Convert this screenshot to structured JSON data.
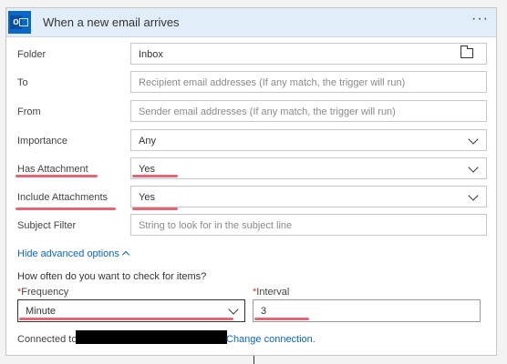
{
  "trigger": {
    "title": "When a new email arrives",
    "menu": "···"
  },
  "fields": {
    "folder": {
      "label": "Folder",
      "value": "Inbox"
    },
    "to": {
      "label": "To",
      "placeholder": "Recipient email addresses (If any match, the trigger will run)"
    },
    "from": {
      "label": "From",
      "placeholder": "Sender email addresses (If any match, the trigger will run)"
    },
    "importance": {
      "label": "Importance",
      "value": "Any"
    },
    "has_attachment": {
      "label": "Has Attachment",
      "value": "Yes"
    },
    "include_attachments": {
      "label": "Include Attachments",
      "value": "Yes"
    },
    "subject_filter": {
      "label": "Subject Filter",
      "placeholder": "String to look for in the subject line"
    }
  },
  "advanced": {
    "toggle_label": "Hide advanced options"
  },
  "schedule": {
    "question": "How often do you want to check for items?",
    "required_mark": "*",
    "frequency": {
      "label": "Frequency",
      "value": "Minute"
    },
    "interval": {
      "label": "Interval",
      "value": "3"
    }
  },
  "connection": {
    "prefix": "Connected to",
    "change_label": "Change connection."
  },
  "colors": {
    "header_bg": "#e1eef9",
    "accent": "#0a67c8",
    "annotation_red": "#e04a5f"
  }
}
